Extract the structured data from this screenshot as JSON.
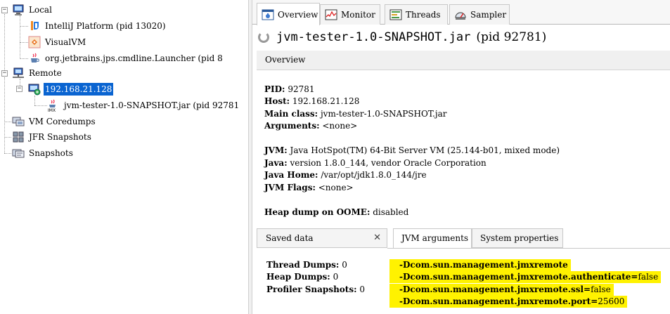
{
  "tree": {
    "local": "Local",
    "intellij": "IntelliJ Platform (pid 13020)",
    "visualvm": "VisualVM",
    "launcher": "org.jetbrains.jps.cmdline.Launcher (pid 8",
    "remote": "Remote",
    "host": "192.168.21.128",
    "jar": "jvm-tester-1.0-SNAPSHOT.jar (pid 92781",
    "coredumps": "VM Coredumps",
    "jfr": "JFR Snapshots",
    "snapshots": "Snapshots"
  },
  "tabs": {
    "overview": "Overview",
    "monitor": "Monitor",
    "threads": "Threads",
    "sampler": "Sampler"
  },
  "app": {
    "title": "jvm-tester-1.0-SNAPSHOT.jar",
    "pid": "(pid 92781)"
  },
  "overview_bar": "Overview",
  "info": {
    "pid_label": "PID:",
    "pid": "92781",
    "host_label": "Host:",
    "host": "192.168.21.128",
    "mainclass_label": "Main class:",
    "mainclass": "jvm-tester-1.0-SNAPSHOT.jar",
    "args_label": "Arguments:",
    "args": "<none>",
    "jvm_label": "JVM:",
    "jvm": "Java HotSpot(TM) 64-Bit Server VM (25.144-b01, mixed mode)",
    "java_label": "Java:",
    "java": "version 1.8.0_144, vendor Oracle Corporation",
    "javahome_label": "Java Home:",
    "javahome": "/var/opt/jdk1.8.0_144/jre",
    "jvmflags_label": "JVM Flags:",
    "jvmflags": "<none>",
    "heapdump_label": "Heap dump on OOME:",
    "heapdump": "disabled"
  },
  "subtabs": {
    "saved": "Saved data",
    "close": "✕",
    "jvmargs": "JVM arguments",
    "sysprops": "System properties"
  },
  "saved": {
    "thread_label": "Thread Dumps:",
    "thread": "0",
    "heap_label": "Heap Dumps:",
    "heap": "0",
    "profiler_label": "Profiler Snapshots:",
    "profiler": "0"
  },
  "jvm_args": [
    {
      "key": "-Dcom.sun.management.jmxremote",
      "val": ""
    },
    {
      "key": "-Dcom.sun.management.jmxremote.authenticate=",
      "val": "false"
    },
    {
      "key": "-Dcom.sun.management.jmxremote.ssl=",
      "val": "false"
    },
    {
      "key": "-Dcom.sun.management.jmxremote.port=",
      "val": "25600"
    }
  ],
  "colors": {
    "selection": "#0a64d1",
    "highlight": "#fff200"
  }
}
